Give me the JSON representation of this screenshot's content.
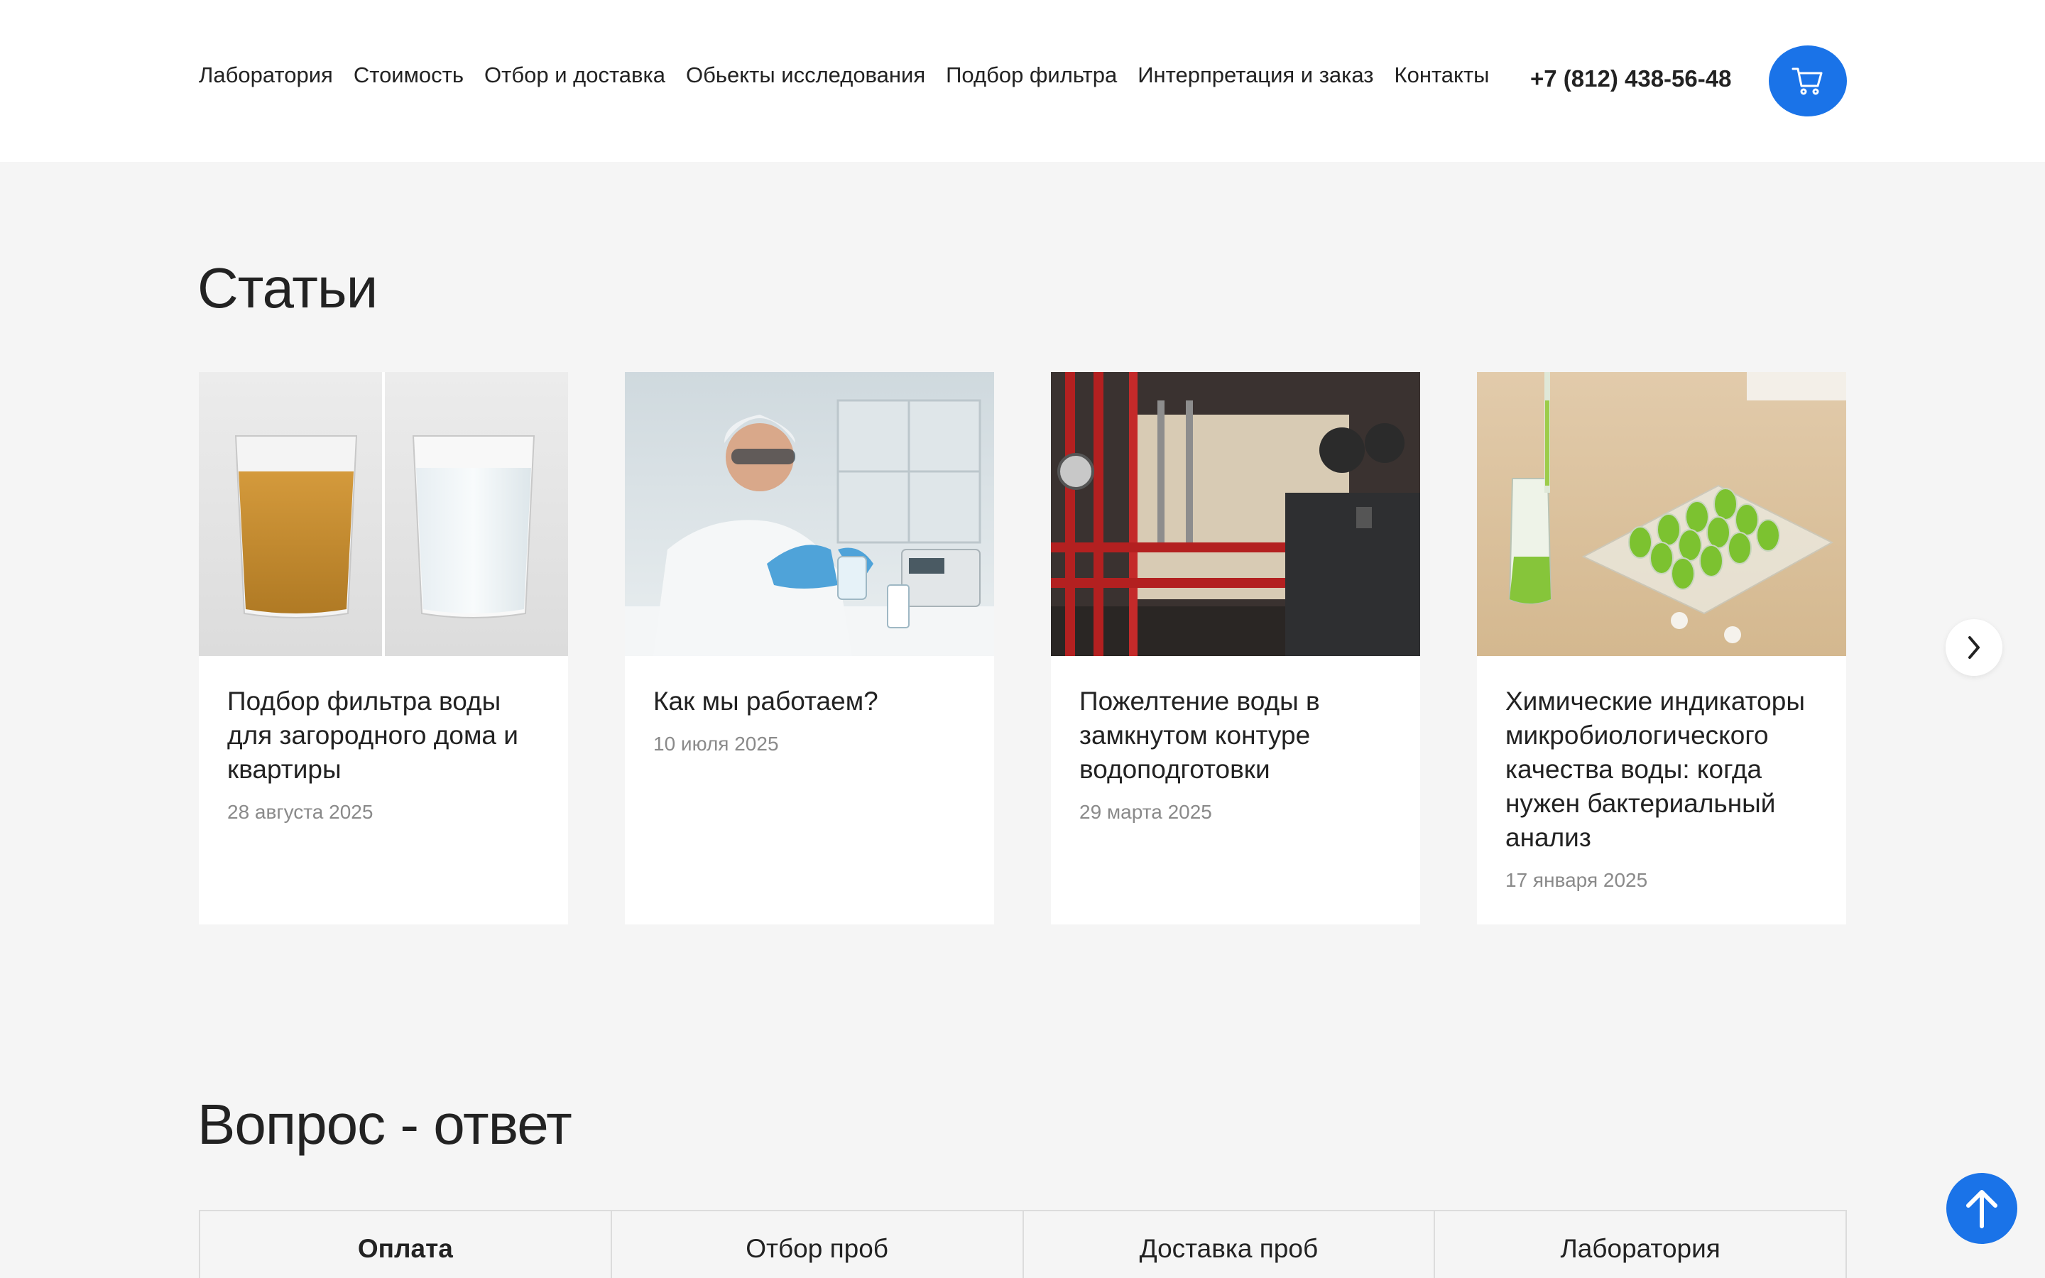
{
  "header": {
    "nav": [
      {
        "label": "Лаборатория"
      },
      {
        "label": "Стоимость"
      },
      {
        "label": "Отбор и доставка"
      },
      {
        "label": "Обьекты исследования"
      },
      {
        "label": "Подбор фильтра"
      },
      {
        "label": "Интерпретация и заказ"
      },
      {
        "label": "Контакты"
      }
    ],
    "phone": "+7 (812) 438-56-48",
    "cart_icon": "cart-icon"
  },
  "articles": {
    "title": "Статьи",
    "cards": [
      {
        "title": "Подбор фильтра воды для загородного дома и квартиры",
        "date": "28 августа 2025",
        "image": "two-glasses-of-water-photo"
      },
      {
        "title": "Как мы работаем?",
        "date": "10 июля 2025",
        "image": "lab-technician-photo"
      },
      {
        "title": "Пожелтение воды в замкнутом контуре водоподготовки",
        "date": "29 марта 2025",
        "image": "boiler-room-pipes-photo"
      },
      {
        "title": "Химические индикаторы микробиологического качества воды: когда нужен бактериальный анализ",
        "date": "17 января 2025",
        "image": "test-tubes-rack-photo"
      }
    ],
    "next_icon": "chevron-right-icon"
  },
  "faq": {
    "title": "Вопрос - ответ",
    "tabs": [
      {
        "label": "Оплата",
        "active": true
      },
      {
        "label": "Отбор проб",
        "active": false
      },
      {
        "label": "Доставка проб",
        "active": false
      },
      {
        "label": "Лаборатория",
        "active": false
      }
    ]
  },
  "scroll_top_icon": "arrow-up-icon",
  "colors": {
    "accent": "#1a73e8",
    "background": "#f5f5f5",
    "card": "#ffffff",
    "date": "#8a8a8a"
  }
}
